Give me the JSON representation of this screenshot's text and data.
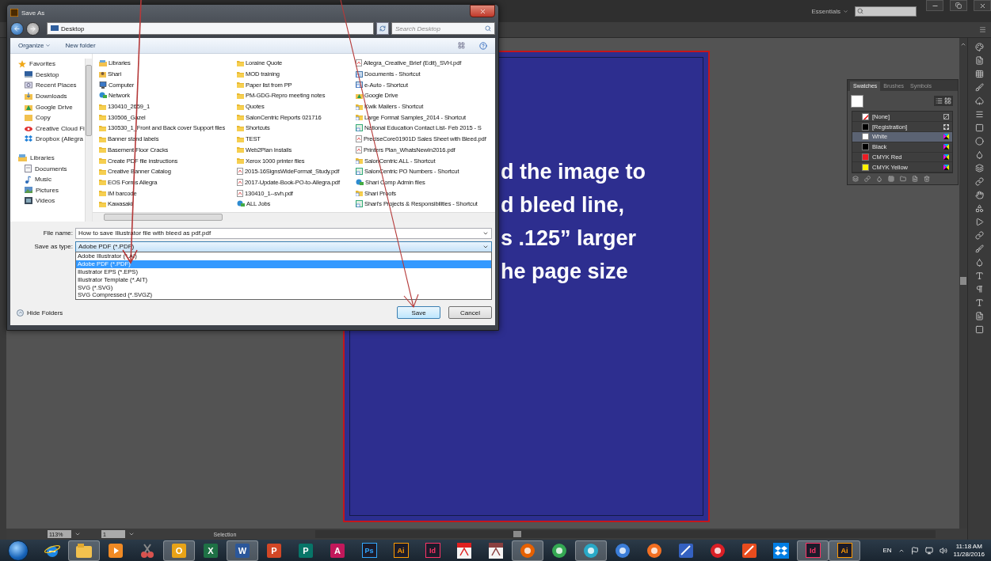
{
  "app": {
    "workspace": "Essentials",
    "zoom": "113%",
    "page": "1",
    "tool": "Selection"
  },
  "artboard": {
    "lines": [
      "d the image to",
      "d bleed line,",
      "s .125” larger",
      "he page size"
    ]
  },
  "swatches_panel": {
    "tabs": [
      {
        "label": "Swatches",
        "selected": true
      },
      {
        "label": "Brushes",
        "selected": false
      },
      {
        "label": "Symbols",
        "selected": false
      }
    ],
    "swatches": [
      {
        "name": "[None]",
        "kind": "none",
        "selected": false
      },
      {
        "name": "[Registration]",
        "kind": "registration",
        "color": "#000000",
        "selected": false
      },
      {
        "name": "White",
        "kind": "process",
        "color": "#ffffff",
        "selected": true
      },
      {
        "name": "Black",
        "kind": "process",
        "color": "#000000",
        "selected": false
      },
      {
        "name": "CMYK Red",
        "kind": "process",
        "color": "#ed1c24",
        "selected": false
      },
      {
        "name": "CMYK Yellow",
        "kind": "process",
        "color": "#fff200",
        "selected": false
      }
    ]
  },
  "dialog": {
    "title": "Save As",
    "path": "Desktop",
    "search_placeholder": "Search Desktop",
    "organize": "Organize",
    "new_folder": "New folder",
    "nav": [
      {
        "label": "Favorites",
        "kind": "star",
        "children": [
          {
            "label": "Desktop",
            "kind": "desktop"
          },
          {
            "label": "Recent Places",
            "kind": "recent"
          },
          {
            "label": "Downloads",
            "kind": "downloads"
          },
          {
            "label": "Google Drive",
            "kind": "drive"
          },
          {
            "label": "Copy",
            "kind": "folder"
          },
          {
            "label": "Creative Cloud Fi",
            "kind": "cloud"
          },
          {
            "label": "Dropbox (Allegra",
            "kind": "dropbox"
          }
        ]
      },
      {
        "label": "Libraries",
        "kind": "library",
        "children": [
          {
            "label": "Documents",
            "kind": "document"
          },
          {
            "label": "Music",
            "kind": "music"
          },
          {
            "label": "Pictures",
            "kind": "pictures"
          },
          {
            "label": "Videos",
            "kind": "videos"
          }
        ]
      }
    ],
    "files": [
      {
        "name": "Libraries",
        "kind": "library"
      },
      {
        "name": "Shari",
        "kind": "user"
      },
      {
        "name": "Computer",
        "kind": "computer"
      },
      {
        "name": "Network",
        "kind": "network"
      },
      {
        "name": "130410_2659_1",
        "kind": "folder"
      },
      {
        "name": "130506_Gazel",
        "kind": "folder"
      },
      {
        "name": "130530_1_Front and Back cover Support files",
        "kind": "folder"
      },
      {
        "name": "Banner stand labels",
        "kind": "folder"
      },
      {
        "name": "Basement Floor Cracks",
        "kind": "folder"
      },
      {
        "name": "Create PDF file instructions",
        "kind": "folder"
      },
      {
        "name": "Creative Banner Catalog",
        "kind": "folder"
      },
      {
        "name": "EOS Forms Allegra",
        "kind": "folder"
      },
      {
        "name": "IM barcode",
        "kind": "folder"
      },
      {
        "name": "Kawasaki",
        "kind": "folder"
      },
      {
        "name": "Loraine Quote",
        "kind": "folder"
      },
      {
        "name": "MOD training",
        "kind": "folder"
      },
      {
        "name": "Paper list from PP",
        "kind": "folder"
      },
      {
        "name": "PM-GDG-Repro meeting notes",
        "kind": "folder"
      },
      {
        "name": "Quotes",
        "kind": "folder"
      },
      {
        "name": "SalonCentric Reports 021716",
        "kind": "folder"
      },
      {
        "name": "Shortcuts",
        "kind": "folder"
      },
      {
        "name": "TEST",
        "kind": "folder"
      },
      {
        "name": "Web2Plan Installs",
        "kind": "folder"
      },
      {
        "name": "Xerox 1000 printer files",
        "kind": "folder"
      },
      {
        "name": "2015-16SignsWideFormat_Study.pdf",
        "kind": "pdf"
      },
      {
        "name": "2017-Update-Book-PO-to-Allegra.pdf",
        "kind": "pdf"
      },
      {
        "name": "130410_1--svh.pdf",
        "kind": "pdf"
      },
      {
        "name": "ALL Jobs",
        "kind": "network"
      },
      {
        "name": "Allegra_Creative_Brief (Edit)_SVH.pdf",
        "kind": "pdf"
      },
      {
        "name": "Documents - Shortcut",
        "kind": "shortcut"
      },
      {
        "name": "e-Auto - Shortcut",
        "kind": "shortcut"
      },
      {
        "name": "Google Drive",
        "kind": "drive"
      },
      {
        "name": "Kwik Mailers - Shortcut",
        "kind": "folder-shortcut"
      },
      {
        "name": "Large Format Samples_2014 - Shortcut",
        "kind": "folder-shortcut"
      },
      {
        "name": "National Education Contact List- Feb 2015 - S",
        "kind": "sheet"
      },
      {
        "name": "PreciseCore01901D Sales Sheet with Bleed.pdf",
        "kind": "pdf"
      },
      {
        "name": "Printers Plan_WhatsNewIn2016.pdf",
        "kind": "pdf"
      },
      {
        "name": "SalonCentric ALL - Shortcut",
        "kind": "folder-shortcut"
      },
      {
        "name": "SalonCentric PO Numbers - Shortcut",
        "kind": "sheet"
      },
      {
        "name": "Shari Comp Admin files",
        "kind": "network"
      },
      {
        "name": "Shari Proofs",
        "kind": "folder-shortcut"
      },
      {
        "name": "Shari's Projects & Responsibilities - Shortcut",
        "kind": "sheet"
      }
    ],
    "file_name_label": "File name:",
    "file_name": "How to save Illustrator file with bleed as pdf.pdf",
    "type_label": "Save as type:",
    "type_value": "Adobe PDF (*.PDF)",
    "type_options": [
      {
        "label": "Adobe Illustrator (*.AI)",
        "selected": false
      },
      {
        "label": "Adobe PDF (*.PDF)",
        "selected": true
      },
      {
        "label": "Illustrator EPS (*.EPS)",
        "selected": false
      },
      {
        "label": "Illustrator Template (*.AIT)",
        "selected": false
      },
      {
        "label": "SVG (*.SVG)",
        "selected": false
      },
      {
        "label": "SVG Compressed (*.SVGZ)",
        "selected": false
      }
    ],
    "hide_folders": "Hide Folders",
    "buttons": [
      {
        "label": "Save",
        "default": true
      },
      {
        "label": "Cancel",
        "default": false
      }
    ]
  },
  "taskbar": {
    "apps": [
      {
        "kind": "ie",
        "color": "#1e88e5",
        "active": false
      },
      {
        "kind": "folder",
        "color": "#f2c14e",
        "active": true
      },
      {
        "kind": "media",
        "color": "#f08a24",
        "active": false
      },
      {
        "kind": "snip",
        "color": "#d9534f",
        "active": false
      },
      {
        "kind": "office",
        "label": "O",
        "color": "#e8a317",
        "active": true
      },
      {
        "kind": "office",
        "label": "X",
        "color": "#1e7145",
        "active": false
      },
      {
        "kind": "office",
        "label": "W",
        "color": "#2b579a",
        "active": true
      },
      {
        "kind": "office",
        "label": "P",
        "color": "#d24726",
        "active": false
      },
      {
        "kind": "office",
        "label": "P",
        "color": "#077568",
        "active": false
      },
      {
        "kind": "office",
        "label": "A",
        "color": "#c2185b",
        "active": false
      },
      {
        "kind": "adobe",
        "label": "Ps",
        "color": "#31a8ff",
        "active": false
      },
      {
        "kind": "adobe",
        "label": "Ai",
        "color": "#ff9a00",
        "active": false
      },
      {
        "kind": "adobe",
        "label": "Id",
        "color": "#ff3366",
        "active": false
      },
      {
        "kind": "acrobat",
        "color": "#e02020",
        "active": false
      },
      {
        "kind": "acrobat",
        "color": "#8a4040",
        "active": false
      },
      {
        "kind": "round",
        "color": "#e66000",
        "active": true
      },
      {
        "kind": "round",
        "color": "#34a853",
        "active": false
      },
      {
        "kind": "round",
        "color": "#29a9c7",
        "active": true
      },
      {
        "kind": "round",
        "color": "#3b7dd8",
        "active": false
      },
      {
        "kind": "round",
        "color": "#f36f21",
        "active": false
      },
      {
        "kind": "square",
        "color": "#3461c1",
        "active": false
      },
      {
        "kind": "round",
        "color": "#da1f26",
        "active": false
      },
      {
        "kind": "square",
        "color": "#e84c1e",
        "active": false
      },
      {
        "kind": "dropbox",
        "color": "#007ee5",
        "active": false
      },
      {
        "kind": "adobe",
        "label": "Id",
        "color": "#ff3366",
        "active": true
      },
      {
        "kind": "adobe",
        "label": "Ai",
        "color": "#ff9a00",
        "active": true
      }
    ],
    "language": "EN",
    "time": "11:18 AM",
    "date": "11/28/2016"
  }
}
